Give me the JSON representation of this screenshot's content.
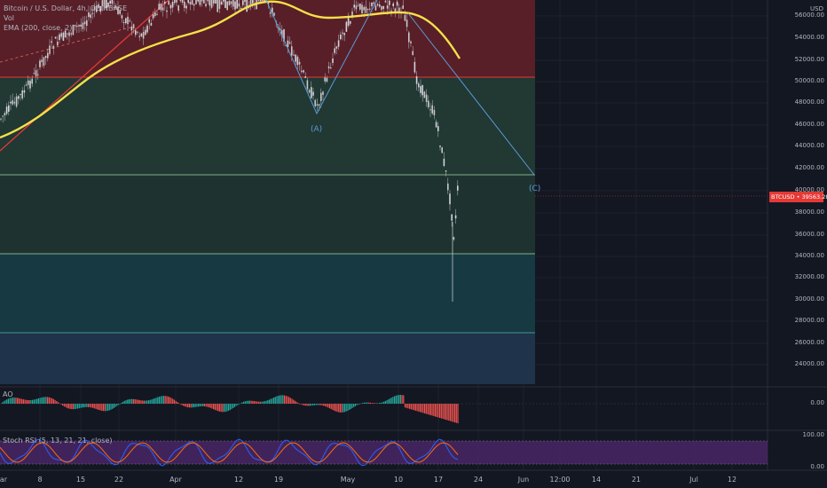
{
  "legend": {
    "symbol": "Bitcoin / U.S. Dollar, 4h, COINBASE",
    "vol": "Vol",
    "ema": "EMA (200, close, 2)"
  },
  "price_axis": {
    "currency": "USD",
    "labels": [
      "56000.00",
      "54000.00",
      "52000.00",
      "50000.00",
      "48000.00",
      "46000.00",
      "44000.00",
      "42000.00",
      "40000.00",
      "38000.00",
      "36000.00",
      "34000.00",
      "32000.00",
      "30000.00",
      "28000.00",
      "26000.00",
      "24000.00"
    ]
  },
  "last_price": {
    "ticker": "BTCUSD",
    "value": "39563.28",
    "color": "#e53935"
  },
  "wave_labels": {
    "a": "(A)",
    "c": "(C)"
  },
  "panes": {
    "ao": {
      "label": "AO",
      "axis": [
        "0.00"
      ]
    },
    "stoch": {
      "label": "Stoch RSI (5, 13, 21, 21, close)",
      "axis": [
        "100.00",
        "0.00"
      ]
    }
  },
  "time_axis": [
    "ar",
    "8",
    "15",
    "22",
    "Apr",
    "12",
    "19",
    "May",
    "10",
    "17",
    "24",
    "Jun",
    "12:00",
    "14",
    "21",
    "Jul",
    "12"
  ],
  "colors": {
    "ema": "#f5e04a",
    "trend": "#e53935",
    "wave": "#5b9bd5",
    "zone_red": "#5c2029",
    "zone_green": "#223a35",
    "zone_teal": "#173b45",
    "zone_blue": "#20354d",
    "stoch_band": "#4a2666"
  }
}
